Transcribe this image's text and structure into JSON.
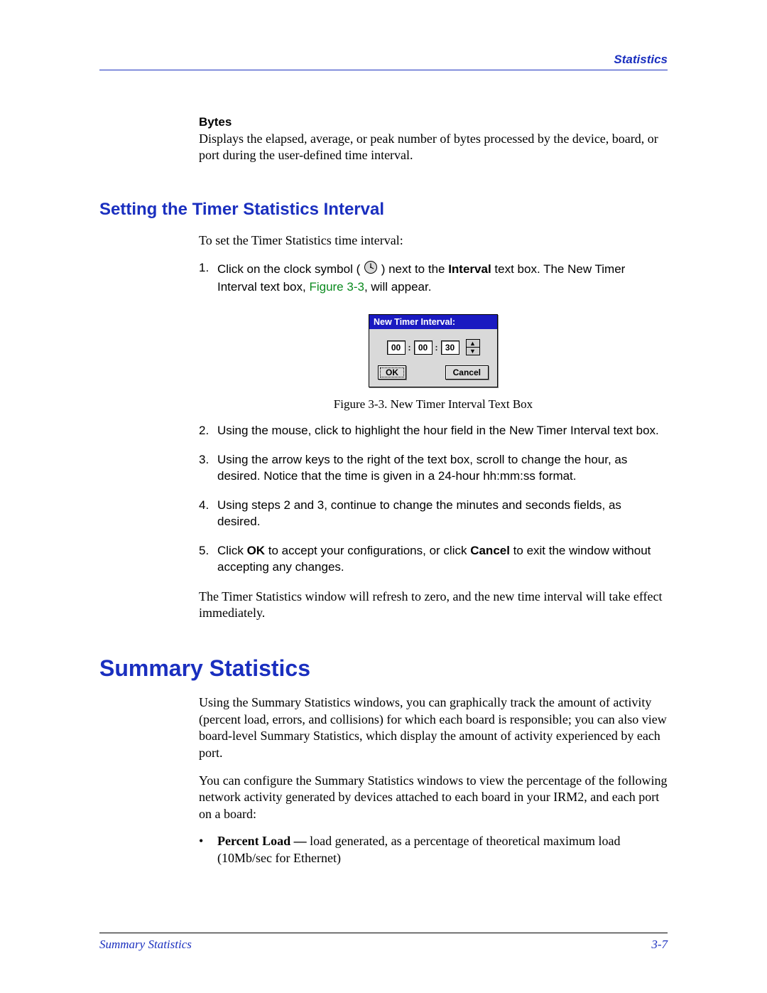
{
  "header": {
    "label": "Statistics"
  },
  "bytes": {
    "label": "Bytes",
    "text": "Displays the elapsed, average, or peak number of bytes processed by the device, board, or port during the user-defined time interval."
  },
  "section1": {
    "title": "Setting the Timer Statistics Interval",
    "intro": "To set the Timer Statistics time interval:",
    "step1_a": "Click on the clock symbol (",
    "step1_b": ") next to the ",
    "step1_bold": "Interval",
    "step1_c": " text box. The New Timer Interval text box, ",
    "step1_figref": "Figure 3-3",
    "step1_d": ", will appear.",
    "step2": "Using the mouse, click to highlight the hour field in the New Timer Interval text box.",
    "step3": "Using the arrow keys to the right of the text box, scroll to change the hour, as desired. Notice that the time is given in a 24-hour hh:mm:ss format.",
    "step4": "Using steps 2 and 3, continue to change the minutes and seconds fields, as desired.",
    "step5_a": "Click ",
    "step5_ok": "OK",
    "step5_b": " to accept your configurations, or click ",
    "step5_cancel": "Cancel",
    "step5_c": " to exit the window without accepting any changes.",
    "after": "The Timer Statistics window will refresh to zero, and the new time interval will take effect immediately."
  },
  "dialog": {
    "title": "New Timer Interval:",
    "hh": "00",
    "mm": "00",
    "ss": "30",
    "ok": "OK",
    "cancel": "Cancel",
    "caption": "Figure 3-3.  New Timer Interval Text Box"
  },
  "section2": {
    "title": "Summary Statistics",
    "p1": "Using the Summary Statistics windows, you can graphically track the amount of activity (percent load, errors, and collisions) for which each board is responsible; you can also view board-level Summary Statistics, which display the amount of activity experienced by each port.",
    "p2": "You can configure the Summary Statistics windows to view the percentage of the following network activity generated by devices attached to each board in your IRM2, and each port on a board:",
    "bullet1_bold": "Percent Load — ",
    "bullet1_rest": "load generated, as a percentage of theoretical maximum load (10Mb/sec for Ethernet)"
  },
  "footer": {
    "left": "Summary Statistics",
    "right": "3-7"
  }
}
